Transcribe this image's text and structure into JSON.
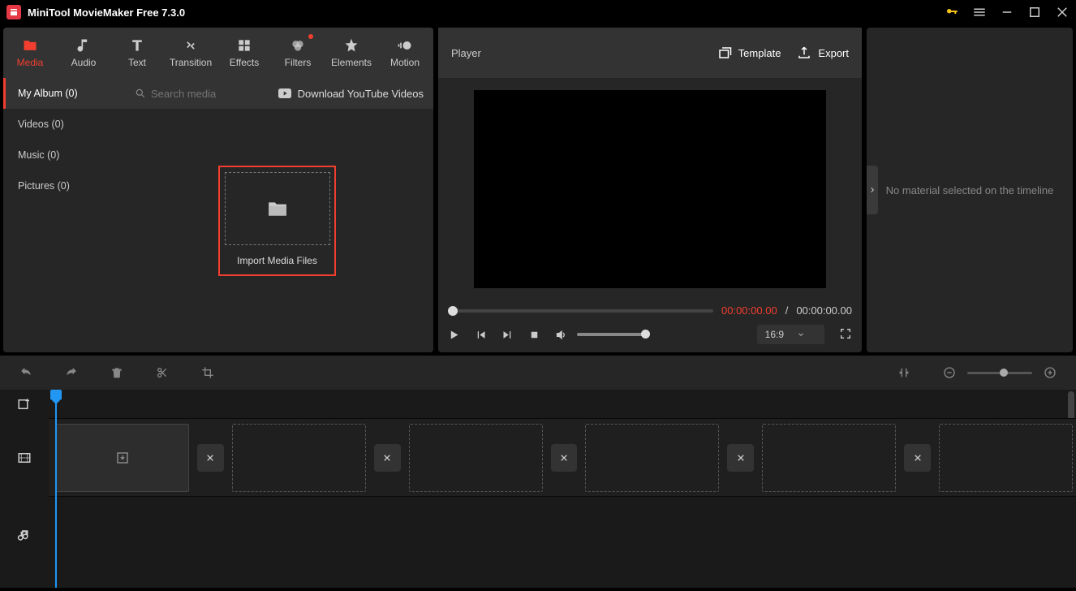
{
  "app": {
    "title": "MiniTool MovieMaker Free 7.3.0"
  },
  "tabs": {
    "media": "Media",
    "audio": "Audio",
    "text": "Text",
    "transition": "Transition",
    "effects": "Effects",
    "filters": "Filters",
    "elements": "Elements",
    "motion": "Motion"
  },
  "sidebar": {
    "items": [
      {
        "label": "My Album (0)"
      },
      {
        "label": "Videos (0)"
      },
      {
        "label": "Music (0)"
      },
      {
        "label": "Pictures (0)"
      }
    ]
  },
  "search": {
    "placeholder": "Search media"
  },
  "download_yt": "Download YouTube Videos",
  "import": {
    "label": "Import Media Files"
  },
  "player": {
    "title": "Player",
    "template": "Template",
    "export": "Export",
    "time_current": "00:00:00.00",
    "time_sep": "/",
    "time_total": "00:00:00.00",
    "aspect": "16:9"
  },
  "inspector": {
    "message": "No material selected on the timeline"
  }
}
